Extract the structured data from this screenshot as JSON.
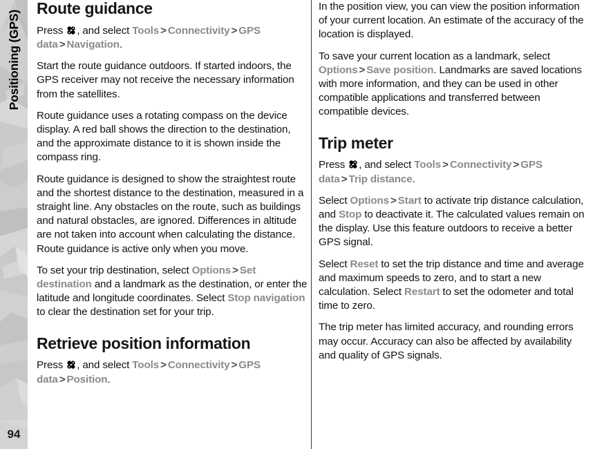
{
  "sidebar": {
    "chapter_label": "Positioning (GPS)",
    "page_number": "94",
    "background_color": "#c9c9c9"
  },
  "colors": {
    "ui_term_gray": "#8a8a8a",
    "body_black": "#121212",
    "heading_black": "#161616",
    "divider": "#3a3a3a"
  },
  "icons": {
    "menu_key": "menu-key-icon"
  },
  "left_column": {
    "heading_1": "Route guidance",
    "press_label": "Press",
    "and_select_label": ", and select",
    "path_1": {
      "items": [
        "Tools",
        "Connectivity",
        "GPS data",
        "Navigation"
      ],
      "separator": ">",
      "terminator": "."
    },
    "paragraph_1": "Start the route guidance outdoors. If started indoors, the GPS receiver may not receive the necessary information from the satellites.",
    "paragraph_2": "Route guidance uses a rotating compass on the device display. A red ball shows the direction to the destination, and the approximate distance to it is shown inside the compass ring.",
    "paragraph_3": "Route guidance is designed to show the straightest route and the shortest distance to the destination, measured in a straight line. Any obstacles on the route, such as buildings and natural obstacles, are ignored. Differences in altitude are not taken into account when calculating the distance. Route guidance is active only when you move.",
    "paragraph_4": {
      "part_1": "To set your trip destination, select",
      "term_1": "Options",
      "separator": ">",
      "term_2": "Set destination",
      "part_2": "and a landmark as the destination, or enter the latitude and longitude coordinates. Select",
      "term_3": "Stop navigation",
      "part_3": "to clear the destination set for your trip."
    },
    "heading_2": "Retrieve position information",
    "path_2": {
      "items": [
        "Tools",
        "Connectivity",
        "GPS data",
        "Position"
      ],
      "separator": ">",
      "terminator": "."
    }
  },
  "right_column": {
    "paragraph_1": "In the position view, you can view the position information of your current location. An estimate of the accuracy of the location is displayed.",
    "paragraph_2": {
      "part_1": "To save your current location as a landmark, select",
      "term_1": "Options",
      "separator": ">",
      "term_2": "Save position",
      "part_2": ". Landmarks are saved locations with more information, and they can be used in other compatible applications and transferred between compatible devices."
    },
    "heading_1": "Trip meter",
    "press_label": "Press",
    "and_select_label": ", and select",
    "path_1": {
      "items": [
        "Tools",
        "Connectivity",
        "GPS data",
        "Trip distance"
      ],
      "separator": ">",
      "terminator": "."
    },
    "paragraph_3": {
      "part_1": "Select",
      "term_1": "Options",
      "separator": ">",
      "term_2": "Start",
      "part_2": "to activate trip distance calculation, and",
      "term_3": "Stop",
      "part_3": "to deactivate it. The calculated values remain on the display. Use this feature outdoors to receive a better GPS signal."
    },
    "paragraph_4": {
      "part_1": "Select",
      "term_1": "Reset",
      "part_2": "to set the trip distance and time and average and maximum speeds to zero, and to start a new calculation. Select",
      "term_2": "Restart",
      "part_3": "to set the odometer and total time to zero."
    },
    "paragraph_5": "The trip meter has limited accuracy, and rounding errors may occur. Accuracy can also be affected by availability and quality of GPS signals."
  }
}
